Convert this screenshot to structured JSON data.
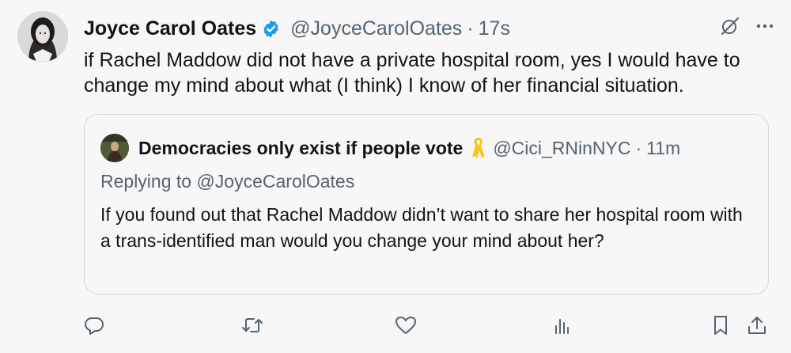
{
  "tweet": {
    "author": {
      "name": "Joyce Carol Oates",
      "handle": "@JoyceCarolOates",
      "verified": true
    },
    "separator": "·",
    "timestamp": "17s",
    "text": "if Rachel Maddow did not have a private hospital room, yes I would have to change my mind about what (I think) I know of her financial situation."
  },
  "quoted": {
    "author": {
      "name": "Democracies only exist if people vote",
      "handle": "@Cici_RNinNYC"
    },
    "separator": "·",
    "timestamp": "11m",
    "replying_to": "Replying to @JoyceCarolOates",
    "text": "If you found out that Rachel Maddow didn’t want to share her hospital room with a trans-identified man would you change your mind about her?"
  },
  "icons": {
    "header": [
      "grok-icon",
      "more-icon"
    ],
    "actions": [
      "reply-icon",
      "retweet-icon",
      "like-icon",
      "views-icon",
      "bookmark-icon",
      "share-icon"
    ]
  },
  "colors": {
    "verified": "#1d9bf0",
    "secondary_text": "#536471",
    "ribbon": "#f5c518",
    "border": "#cfd9de"
  }
}
